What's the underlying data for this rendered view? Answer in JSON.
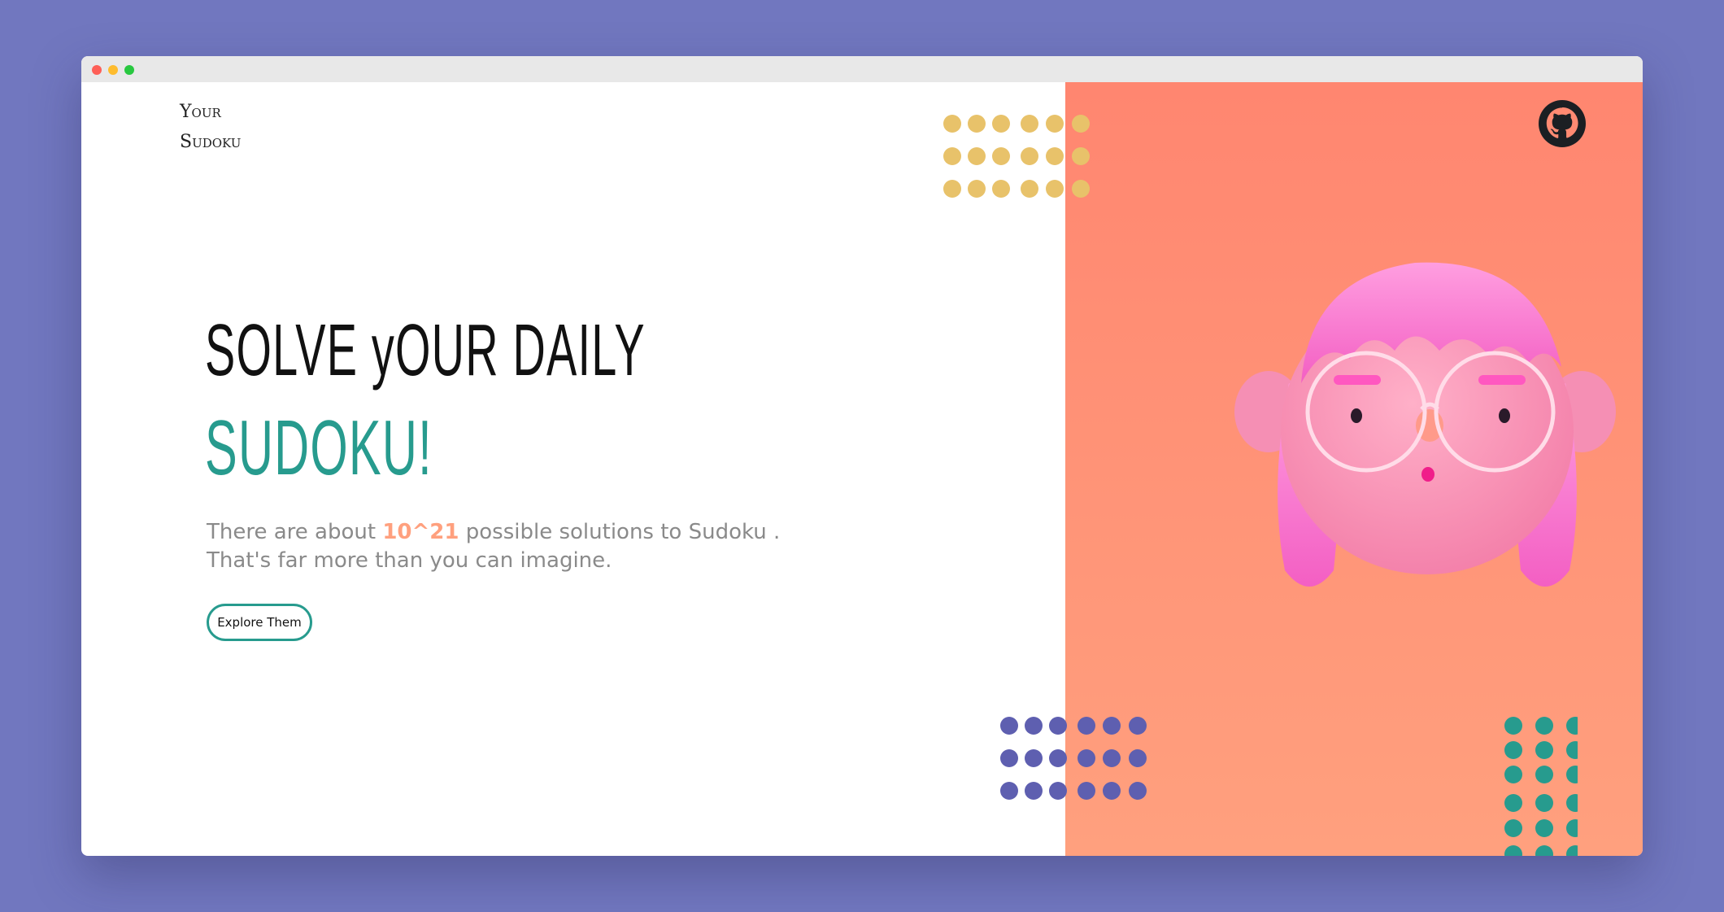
{
  "app": {
    "logo_line1": "Your",
    "logo_line2": "Sudoku"
  },
  "hero": {
    "headline_line1": "SOLVE yOUR DAILY",
    "headline_line2": "SUDOKU!",
    "desc_before": "There are about ",
    "desc_highlight": "10^21",
    "desc_after": " possible solutions to Sudoku .",
    "desc_line2": "That's far more than you can imagine.",
    "cta_label": "Explore Them"
  },
  "icons": {
    "github": "github-icon",
    "avatar": "avatar-illustration"
  },
  "colors": {
    "page_background": "#7177bf",
    "accent_teal": "#279b8e",
    "accent_orange": "#ffa07e",
    "panel_top": "#ff8670",
    "panel_bottom": "#ffa07e",
    "dots_yellow": "#e8c26a",
    "dots_purple": "#5e5fb0",
    "dots_teal": "#279b8e"
  }
}
